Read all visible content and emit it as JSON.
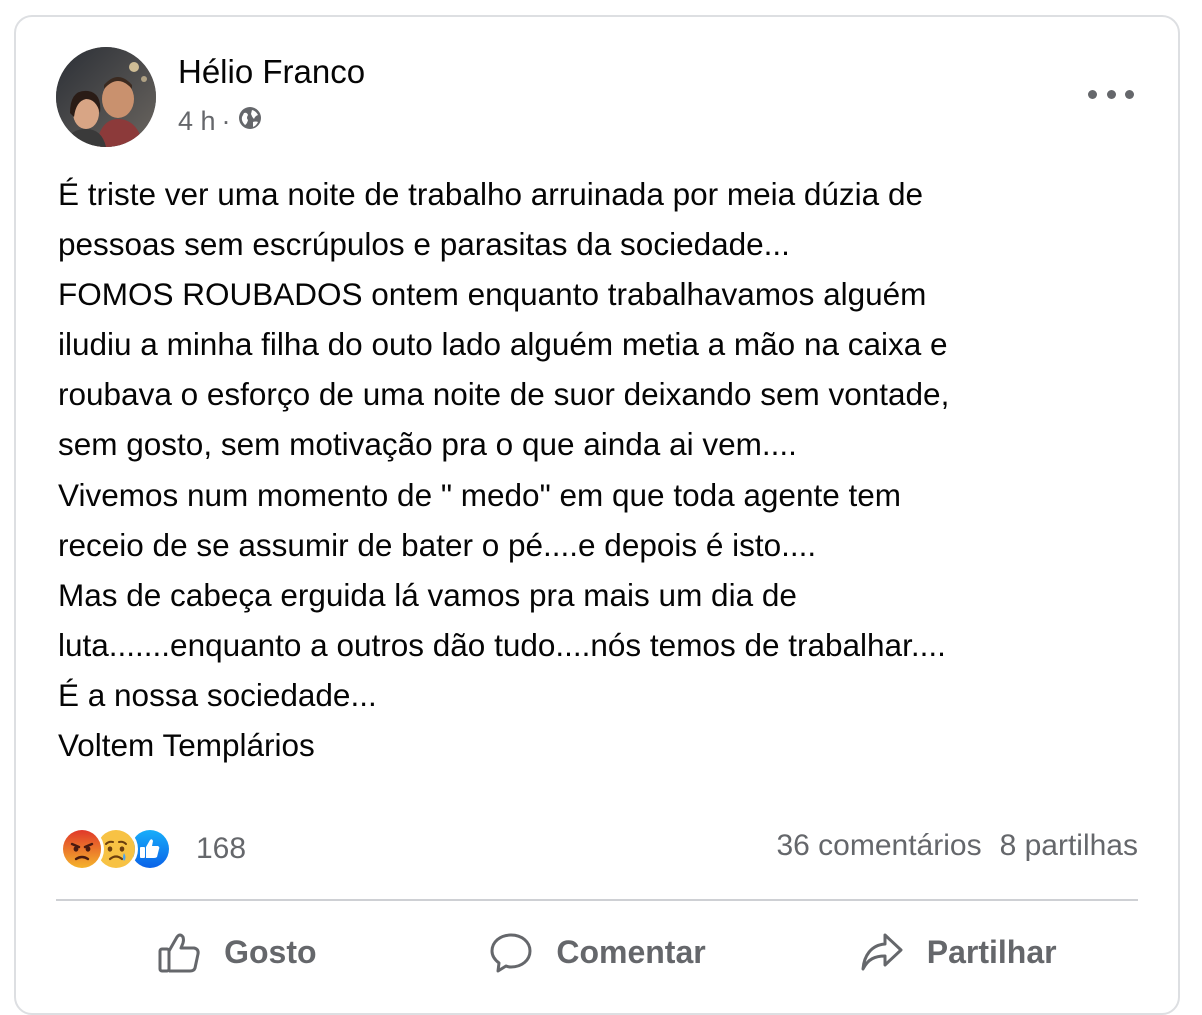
{
  "post": {
    "author": "Hélio Franco",
    "time": "4 h",
    "separator": "·",
    "visibility_icon": "globe-icon",
    "more_icon": "more-options-icon",
    "text": "É triste ver uma noite de trabalho arruinada por meia dúzia de\npessoas sem escrúpulos e parasitas da sociedade...\nFOMOS ROUBADOS ontem enquanto trabalhavamos alguém\niludiu a minha filha  do outo lado alguém metia a mão na caixa e\nroubava o esforço de uma noite de suor deixando sem vontade,\nsem gosto, sem motivação pra o que ainda ai vem....\nVivemos num momento de \" medo\" em que toda agente tem\nreceio de se assumir  de bater o pé....e depois é isto....\nMas de cabeça erguida lá vamos pra mais um dia de\nluta.......enquanto a outros dão tudo....nós temos de trabalhar....\nÉ a nossa sociedade...\nVoltem Templários"
  },
  "stats": {
    "reaction_icons": [
      "angry-reaction-icon",
      "sad-reaction-icon",
      "like-reaction-icon"
    ],
    "reaction_count": "168",
    "comments": "36 comentários",
    "shares": "8 partilhas"
  },
  "actions": {
    "like_label": "Gosto",
    "comment_label": "Comentar",
    "share_label": "Partilhar"
  },
  "colors": {
    "text": "#050505",
    "secondary": "#65676b",
    "like_blue": "#1877f2",
    "angry": "#e8531d",
    "sad": "#f7b125"
  }
}
